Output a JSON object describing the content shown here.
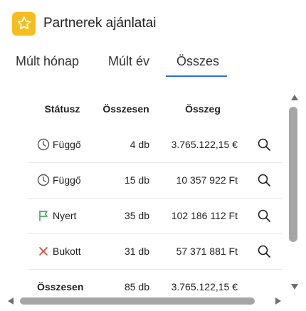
{
  "header": {
    "title": "Partnerek ajánlatai",
    "logo_icon": "star-icon",
    "logo_color": "#f7bd1d"
  },
  "tabs": [
    {
      "label": "Múlt hónap",
      "active": false
    },
    {
      "label": "Múlt év",
      "active": false
    },
    {
      "label": "Összes",
      "active": true
    }
  ],
  "accent_color": "#2f6fd6",
  "table": {
    "columns": [
      "Státusz",
      "Összesen",
      "Összeg"
    ],
    "rows": [
      {
        "status": "Függő",
        "icon": "clock-icon",
        "count": "4 db",
        "amount": "3.765.122,15 €"
      },
      {
        "status": "Függő",
        "icon": "clock-icon",
        "count": "15 db",
        "amount": "10 357 922 Ft"
      },
      {
        "status": "Nyert",
        "icon": "flag-icon",
        "icon_color": "#2e9e4f",
        "count": "35 db",
        "amount": "102 186 112 Ft"
      },
      {
        "status": "Bukott",
        "icon": "x-icon",
        "icon_color": "#e0453a",
        "count": "31 db",
        "amount": "57 371 881 Ft"
      }
    ],
    "total": {
      "label": "Összesen",
      "count": "85 db",
      "amount": "3.765.122,15 €"
    }
  }
}
